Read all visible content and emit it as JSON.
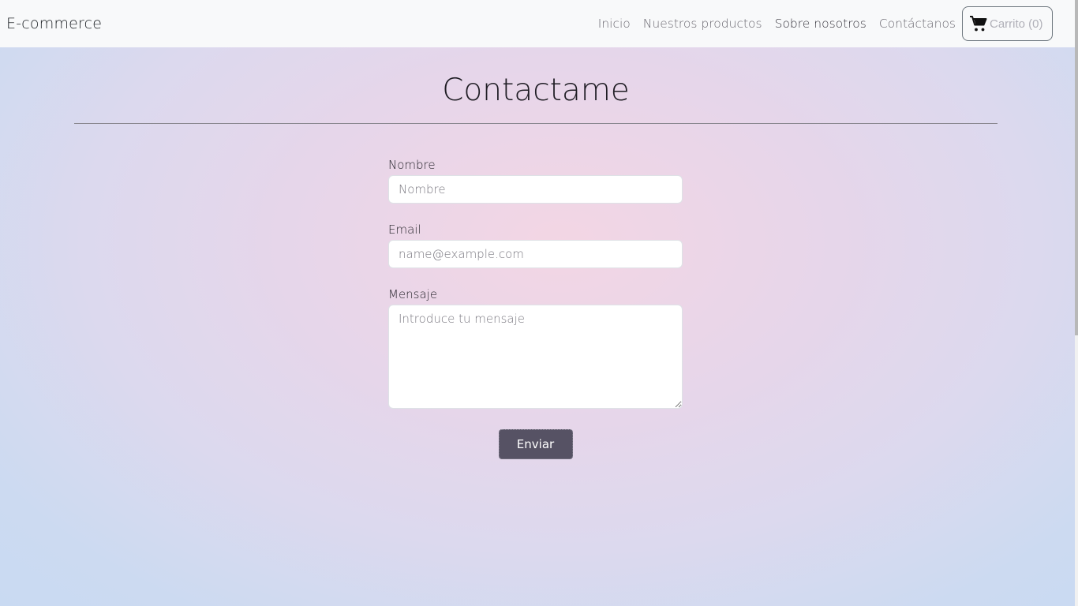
{
  "navbar": {
    "brand": "E-commerce",
    "links": [
      {
        "label": "Inicio"
      },
      {
        "label": "Nuestros productos"
      },
      {
        "label": "Sobre nosotros"
      },
      {
        "label": "Contáctanos"
      }
    ],
    "cart": {
      "label": "Carrito (0)",
      "icon": "cart-icon"
    }
  },
  "main": {
    "title": "Contactame",
    "form": {
      "name": {
        "label": "Nombre",
        "placeholder": "Nombre",
        "value": ""
      },
      "email": {
        "label": "Email",
        "placeholder": "name@example.com",
        "value": ""
      },
      "message": {
        "label": "Mensaje",
        "placeholder": "Introduce tu mensaje",
        "value": ""
      },
      "submit_label": "Enviar"
    }
  },
  "colors": {
    "navbar_bg": "#f8f9fa",
    "button_bg": "#565264",
    "background_center": "#f3d6e4",
    "background_edge": "#c9daf2"
  }
}
